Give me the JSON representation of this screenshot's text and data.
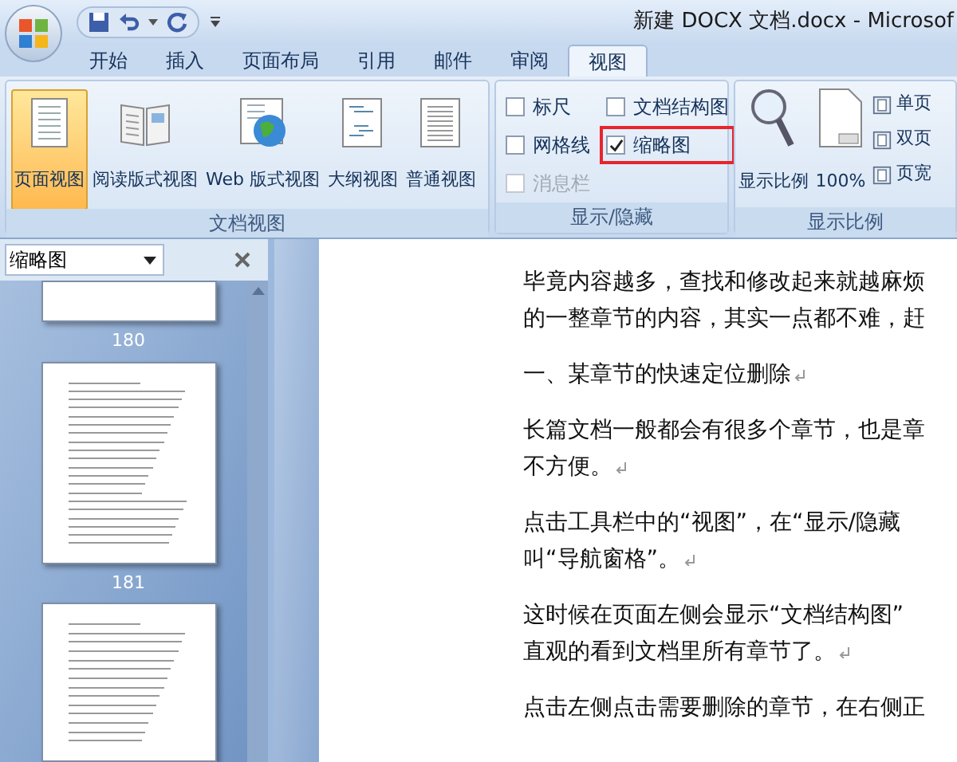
{
  "window": {
    "title": "新建 DOCX 文档.docx - Microsof"
  },
  "tabs": [
    {
      "label": "开始",
      "selected": false
    },
    {
      "label": "插入",
      "selected": false
    },
    {
      "label": "页面布局",
      "selected": false
    },
    {
      "label": "引用",
      "selected": false
    },
    {
      "label": "邮件",
      "selected": false
    },
    {
      "label": "审阅",
      "selected": false
    },
    {
      "label": "视图",
      "selected": true
    }
  ],
  "ribbon": {
    "groups": [
      {
        "kind": "views",
        "label": "文档视图",
        "buttons": [
          {
            "label": "页面视图",
            "selected": true
          },
          {
            "label": "阅读版式视图",
            "selected": false
          },
          {
            "label": "Web 版式视图",
            "selected": false
          },
          {
            "label": "大纲视图",
            "selected": false
          },
          {
            "label": "普通视图",
            "selected": false
          }
        ]
      },
      {
        "kind": "checks",
        "label": "显示/隐藏",
        "items": [
          {
            "label": "标尺",
            "checked": false,
            "disabled": false,
            "highlighted": false
          },
          {
            "label": "网格线",
            "checked": false,
            "disabled": false,
            "highlighted": false
          },
          {
            "label": "消息栏",
            "checked": false,
            "disabled": true,
            "highlighted": false
          },
          {
            "label": "文档结构图",
            "checked": false,
            "disabled": false,
            "highlighted": false
          },
          {
            "label": "缩略图",
            "checked": true,
            "disabled": false,
            "highlighted": true
          }
        ]
      },
      {
        "kind": "zoom",
        "label": "显示比例",
        "buttons": [
          {
            "label": "显示比例"
          },
          {
            "label": "100%"
          }
        ],
        "small_buttons": [
          {
            "label": "单页"
          },
          {
            "label": "双页"
          },
          {
            "label": "页宽"
          }
        ]
      }
    ]
  },
  "nav_pane": {
    "title": "缩略图",
    "page_labels": [
      "180",
      "181"
    ]
  },
  "document": {
    "paragraphs": [
      {
        "lines": [
          "毕竟内容越多，查找和修改起来就越麻烦",
          "的一整章节的内容，其实一点都不难，赶"
        ]
      },
      {
        "lines": [
          "一、某章节的快速定位删除"
        ],
        "mark": true
      },
      {
        "lines": [
          "长篇文档一般都会有很多个章节，也是章",
          "不方便。"
        ],
        "mark": true
      },
      {
        "lines": [
          "点击工具栏中的“视图”，在“显示/隐藏",
          "叫“导航窗格”。"
        ],
        "mark": true
      },
      {
        "lines": [
          "这时候在页面左侧会显示“文档结构图”",
          "直观的看到文档里所有章节了。"
        ],
        "mark": true
      },
      {
        "lines": [
          "点击左侧点击需要删除的章节，在右侧正"
        ],
        "mark": false
      }
    ]
  }
}
